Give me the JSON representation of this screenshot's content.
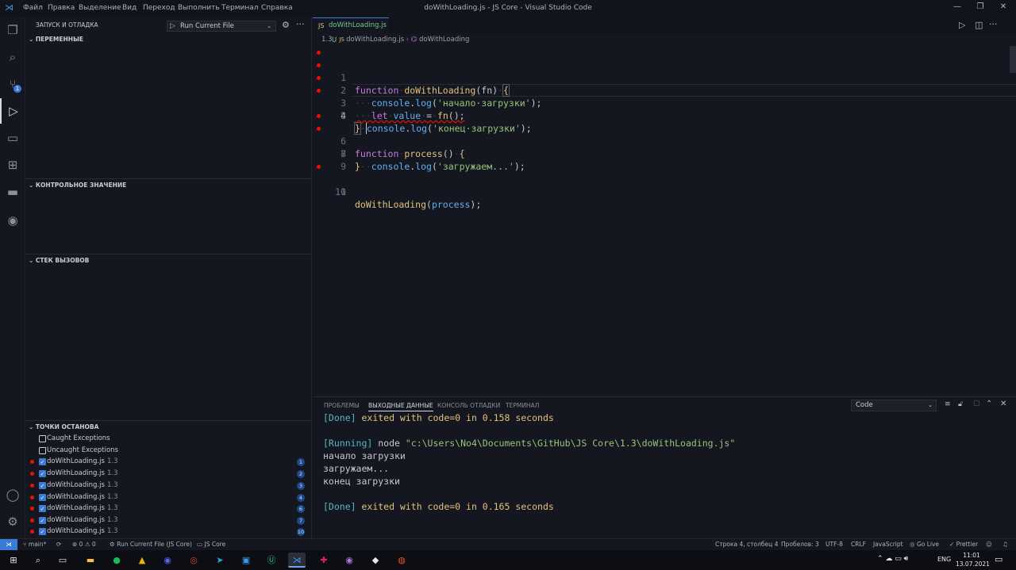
{
  "window": {
    "title": "doWithLoading.js - JS Core - Visual Studio Code",
    "menu": [
      "Файл",
      "Правка",
      "Выделение",
      "Вид",
      "Переход",
      "Выполнить",
      "Терминал",
      "Справка"
    ]
  },
  "activity": {
    "scm_badge": "1"
  },
  "sidebar": {
    "header": "ЗАПУСК И ОТЛАДКА",
    "run_config": "Run Current File",
    "variables": "ПЕРЕМЕННЫЕ",
    "watch": "КОНТРОЛЬНОЕ ЗНАЧЕНИЕ",
    "callstack": "СТЕК ВЫЗОВОВ",
    "breakpoints": "ТОЧКИ ОСТАНОВА",
    "caught": "Caught Exceptions",
    "uncaught": "Uncaught Exceptions",
    "bp_items": [
      {
        "file": "doWithLoading.js",
        "folder": "1.3",
        "line": "1"
      },
      {
        "file": "doWithLoading.js",
        "folder": "1.3",
        "line": "2"
      },
      {
        "file": "doWithLoading.js",
        "folder": "1.3",
        "line": "3"
      },
      {
        "file": "doWithLoading.js",
        "folder": "1.3",
        "line": "4"
      },
      {
        "file": "doWithLoading.js",
        "folder": "1.3",
        "line": "6"
      },
      {
        "file": "doWithLoading.js",
        "folder": "1.3",
        "line": "7"
      },
      {
        "file": "doWithLoading.js",
        "folder": "1.3",
        "line": "10"
      }
    ]
  },
  "editor": {
    "tab_label": "doWithLoading.js",
    "tab_status": "U",
    "crumb_folder": "1.3",
    "crumb_file": "doWithLoading.js",
    "crumb_symbol": "doWithLoading",
    "line_numbers": [
      "1",
      "2",
      "3",
      "4",
      "5",
      "6",
      "7",
      "8",
      "9",
      "10",
      "11"
    ]
  },
  "panel": {
    "tabs": [
      "ПРОБЛЕМЫ",
      "ВЫХОДНЫЕ ДАННЫЕ",
      "КОНСОЛЬ ОТЛАДКИ",
      "ТЕРМИНАЛ"
    ],
    "output_channel": "Code",
    "lines": {
      "done1_tag": "[Done]",
      "done1_rest": " exited with code=0 in 0.158 seconds",
      "running_tag": "[Running]",
      "running_cmd": " node ",
      "running_path": "\"c:\\Users\\No4\\Documents\\GitHub\\JS Core\\1.3\\doWithLoading.js\"",
      "out1": "начало загрузки",
      "out2": "загружаем...",
      "out3": "конец загрузки",
      "done2_tag": "[Done]",
      "done2_rest": " exited with code=0 in 0.165 seconds"
    }
  },
  "status": {
    "branch": "main*",
    "problems": "⊗ 0 ⚠ 0",
    "run": "Run Current File (JS Core)",
    "workspace": "JS Core",
    "position": "Строка 4, столбец 4",
    "spaces": "Пробелов: 3",
    "encoding": "UTF-8",
    "eol": "CRLF",
    "language": "JavaScript",
    "golive": "Go Live",
    "prettier": "Prettier"
  },
  "taskbar": {
    "lang": "ENG",
    "time": "11:01",
    "date": "13.07.2021"
  }
}
